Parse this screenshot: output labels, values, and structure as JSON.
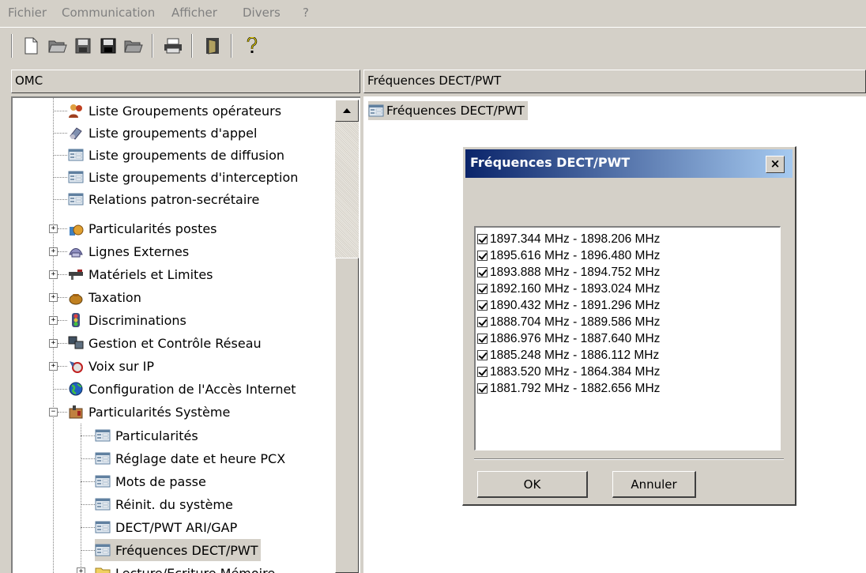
{
  "menubar": {
    "items": [
      "Fichier",
      "Communication",
      "Afficher",
      "Divers",
      "?"
    ]
  },
  "toolbar": {
    "buttons": [
      "new-file-icon",
      "open-folder-icon",
      "save-icon",
      "save-all-icon",
      "export-icon",
      "print-icon",
      "exit-door-icon",
      "help-icon"
    ]
  },
  "left_header": {
    "title": "OMC"
  },
  "right_header": {
    "title": "Fréquences DECT/PWT"
  },
  "right_pane": {
    "item_label": "Fréquences DECT/PWT"
  },
  "tree": {
    "items": [
      {
        "label": "Liste Groupements opérateurs",
        "icon": "operators-icon"
      },
      {
        "label": "Liste groupements d'appel",
        "icon": "call-group-icon"
      },
      {
        "label": "Liste groupements de diffusion",
        "icon": "form-icon"
      },
      {
        "label": "Liste groupements d'interception",
        "icon": "form-icon"
      },
      {
        "label": "Relations patron-secrétaire",
        "icon": "form-icon"
      },
      {
        "label": "Particularités postes",
        "icon": "stations-icon"
      },
      {
        "label": "Lignes Externes",
        "icon": "external-lines-icon"
      },
      {
        "label": "Matériels et Limites",
        "icon": "hardware-icon"
      },
      {
        "label": "Taxation",
        "icon": "money-bag-icon"
      },
      {
        "label": "Discriminations",
        "icon": "traffic-light-icon"
      },
      {
        "label": "Gestion et Contrôle Réseau",
        "icon": "network-icon"
      },
      {
        "label": "Voix sur IP",
        "icon": "voip-icon"
      },
      {
        "label": "Configuration de l'Accès Internet",
        "icon": "globe-icon"
      },
      {
        "label": "Particularités Système",
        "icon": "system-icon"
      },
      {
        "label": "Particularités",
        "icon": "form-icon"
      },
      {
        "label": "Réglage date et heure PCX",
        "icon": "form-icon"
      },
      {
        "label": "Mots de passe",
        "icon": "form-icon"
      },
      {
        "label": "Réinit. du système",
        "icon": "form-icon"
      },
      {
        "label": "DECT/PWT ARI/GAP",
        "icon": "form-icon"
      },
      {
        "label": "Fréquences DECT/PWT",
        "icon": "form-icon"
      },
      {
        "label": "Lecture/Ecriture Mémoire",
        "icon": "folder-icon"
      }
    ]
  },
  "dialog": {
    "title": "Fréquences DECT/PWT",
    "close_label": "×",
    "frequencies": [
      {
        "label": "1897.344 MHz - 1898.206 MHz",
        "checked": true
      },
      {
        "label": "1895.616 MHz - 1896.480 MHz",
        "checked": true
      },
      {
        "label": "1893.888 MHz - 1894.752 MHz",
        "checked": true
      },
      {
        "label": "1892.160 MHz - 1893.024 MHz",
        "checked": true
      },
      {
        "label": "1890.432 MHz - 1891.296 MHz",
        "checked": true
      },
      {
        "label": "1888.704 MHz - 1889.586 MHz",
        "checked": true
      },
      {
        "label": "1886.976 MHz - 1887.640 MHz",
        "checked": true
      },
      {
        "label": "1885.248 MHz - 1886.112 MHz",
        "checked": true
      },
      {
        "label": "1883.520 MHz - 1864.384 MHz",
        "checked": true
      },
      {
        "label": "1881.792 MHz - 1882.656 MHz",
        "checked": true
      }
    ],
    "ok_label": "OK",
    "cancel_label": "Annuler"
  }
}
